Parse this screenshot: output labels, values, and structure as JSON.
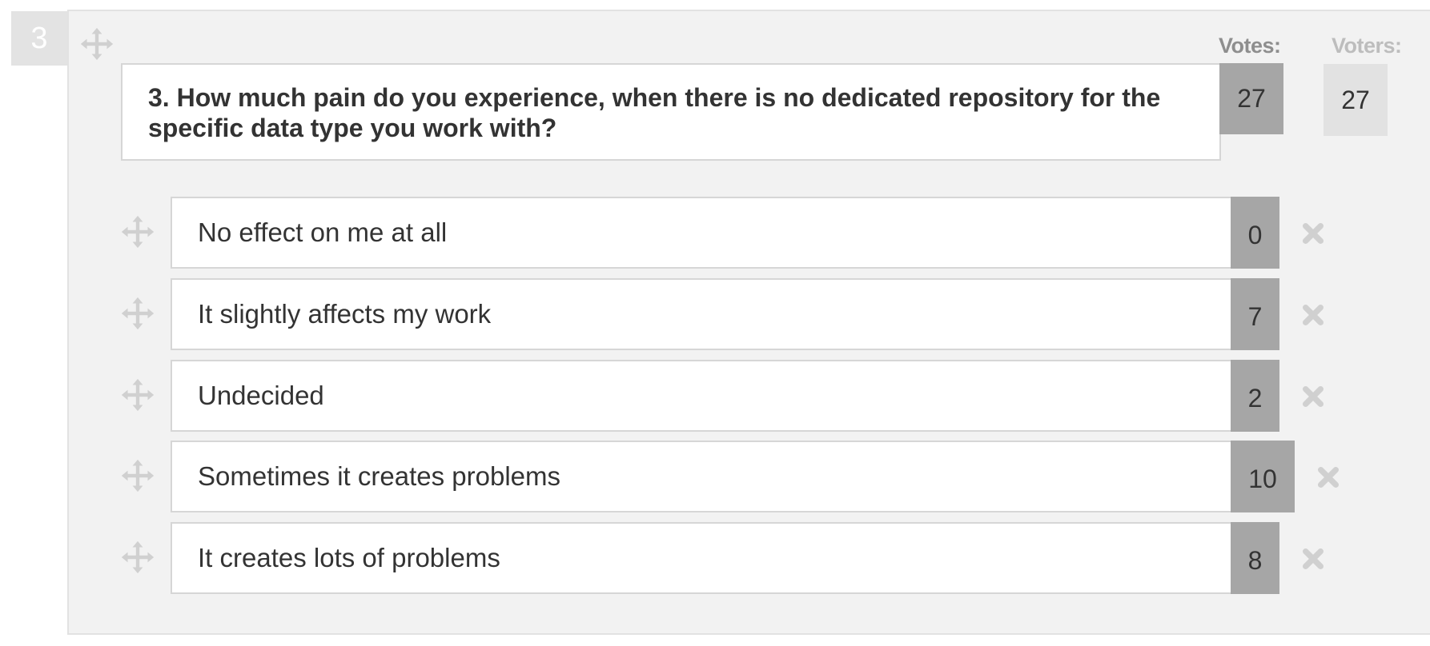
{
  "question": {
    "number_badge": "3",
    "text": "3. How much pain do you experience, when there is no dedicated repository for the specific data type you work with?",
    "votes_label": "Votes:",
    "voters_label": "Voters:",
    "votes": "27",
    "voters": "27"
  },
  "options": [
    {
      "label": "No effect on me at all",
      "count": "0"
    },
    {
      "label": "It slightly affects my work",
      "count": "7"
    },
    {
      "label": "Undecided",
      "count": "2"
    },
    {
      "label": "Sometimes it creates problems",
      "count": "10"
    },
    {
      "label": "It creates lots of problems",
      "count": "8"
    }
  ],
  "icons": {
    "drag_handle": "move-arrows-icon",
    "delete": "close-x-icon"
  },
  "colors": {
    "panel_background": "#f2f2f2",
    "count_box": "#a6a6a6",
    "voters_box": "#e2e2e2",
    "icon_gray": "#d0d0d0",
    "text": "#333333"
  }
}
